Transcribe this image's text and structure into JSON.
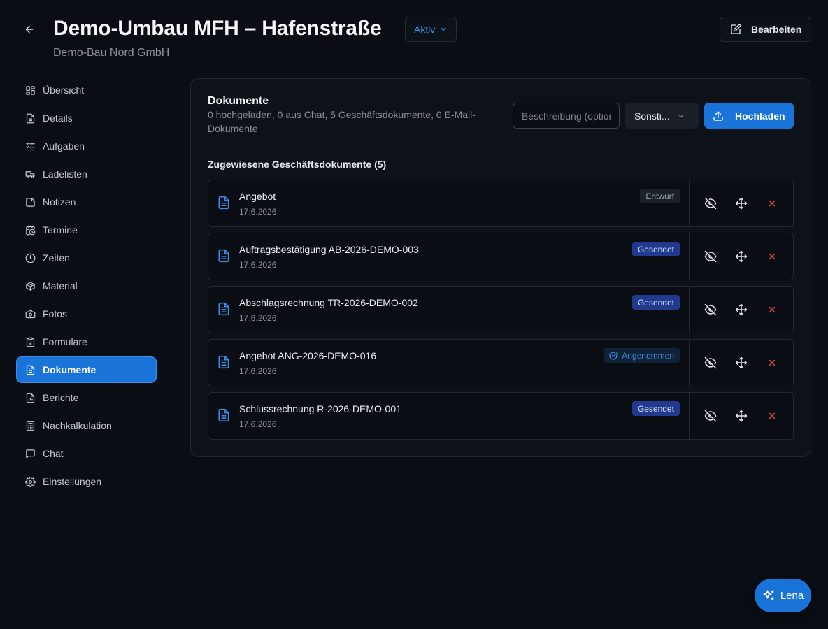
{
  "header": {
    "title": "Demo-Umbau MFH – Hafenstraße",
    "status": "Aktiv",
    "company": "Demo-Bau Nord GmbH",
    "edit_label": "Bearbeiten"
  },
  "sidebar": {
    "items": [
      {
        "label": "Übersicht",
        "icon": "dashboard-icon"
      },
      {
        "label": "Details",
        "icon": "file-text-icon"
      },
      {
        "label": "Aufgaben",
        "icon": "list-checks-icon"
      },
      {
        "label": "Ladelisten",
        "icon": "truck-icon"
      },
      {
        "label": "Notizen",
        "icon": "sticky-note-icon"
      },
      {
        "label": "Termine",
        "icon": "calendar-clock-icon"
      },
      {
        "label": "Zeiten",
        "icon": "clock-icon"
      },
      {
        "label": "Material",
        "icon": "package-icon"
      },
      {
        "label": "Fotos",
        "icon": "camera-icon"
      },
      {
        "label": "Formulare",
        "icon": "clipboard-icon"
      },
      {
        "label": "Dokumente",
        "icon": "file-text-icon",
        "active": true
      },
      {
        "label": "Berichte",
        "icon": "file-chart-icon"
      },
      {
        "label": "Nachkalkulation",
        "icon": "calculator-icon"
      },
      {
        "label": "Chat",
        "icon": "message-square-icon"
      },
      {
        "label": "Einstellungen",
        "icon": "gear-icon"
      }
    ]
  },
  "documents": {
    "title": "Dokumente",
    "summary": "0 hochgeladen, 0 aus Chat, 5 Geschäftsdokumente, 0 E-Mail-Dokumente",
    "description_placeholder": "Beschreibung (optional)",
    "type_value": "Sonsti...",
    "upload_label": "Hochladen",
    "section_heading": "Zugewiesene Geschäftsdokumente (5)",
    "items": [
      {
        "name": "Angebot",
        "date": "17.6.2026",
        "status": "Entwurf",
        "status_kind": "entwurf"
      },
      {
        "name": "Auftragsbestätigung AB-2026-DEMO-003",
        "date": "17.6.2026",
        "status": "Gesendet",
        "status_kind": "gesendet"
      },
      {
        "name": "Abschlagsrechnung TR-2026-DEMO-002",
        "date": "17.6.2026",
        "status": "Gesendet",
        "status_kind": "gesendet"
      },
      {
        "name": "Angebot ANG-2026-DEMO-016",
        "date": "17.6.2026",
        "status": "Angenommen",
        "status_kind": "angenommen"
      },
      {
        "name": "Schlussrechnung R-2026-DEMO-001",
        "date": "17.6.2026",
        "status": "Gesendet",
        "status_kind": "gesendet"
      }
    ]
  },
  "assistant": {
    "label": "Lena",
    "icon": "sparkles-icon"
  },
  "colors": {
    "accent": "#1a73d9",
    "background": "#0a0e14",
    "danger": "#e5484d",
    "badge_sent": "#213a8f"
  }
}
